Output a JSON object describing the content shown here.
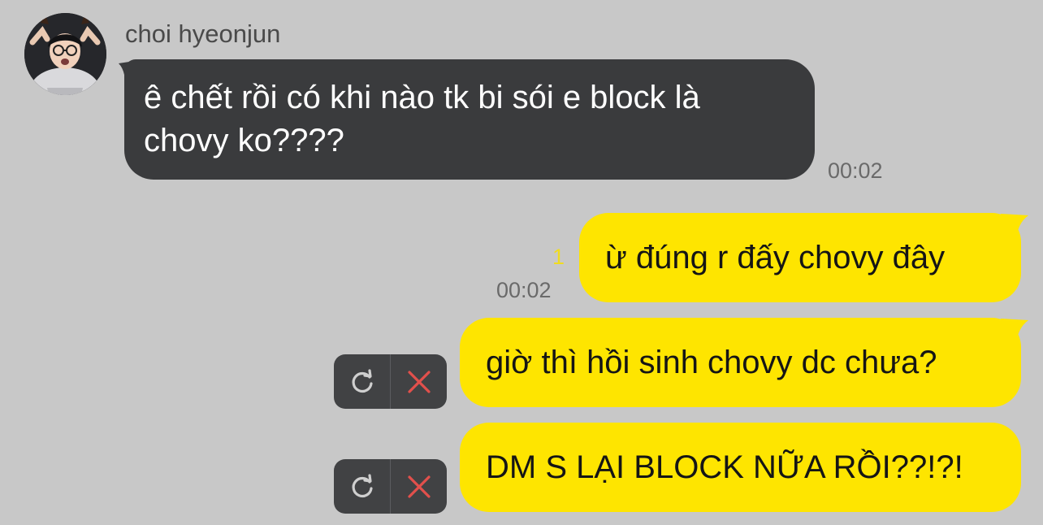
{
  "chat": {
    "incoming": {
      "sender_name": "choi hyeonjun",
      "message_line1": "ê chết rồi có khi nào tk bi sói e block là",
      "message_line2": "chovy ko????",
      "time": "00:02"
    },
    "outgoing": [
      {
        "text": "ừ đúng r đấy chovy đây",
        "time": "00:02",
        "unread_count": "1",
        "status": "sent"
      },
      {
        "text": "giờ thì hồi sinh chovy dc chưa?",
        "status": "failed"
      },
      {
        "text": "DM S LẠI BLOCK NỮA RỒI??!?!",
        "status": "failed"
      }
    ]
  },
  "icons": {
    "retry": "retry-icon",
    "delete": "delete-x-icon"
  },
  "colors": {
    "background": "#c8c8c8",
    "incoming_bubble": "#3a3b3d",
    "outgoing_bubble": "#fee500",
    "unread_indicator": "#f0dc1e",
    "delete_x": "#e2504c",
    "action_box": "#414244"
  }
}
